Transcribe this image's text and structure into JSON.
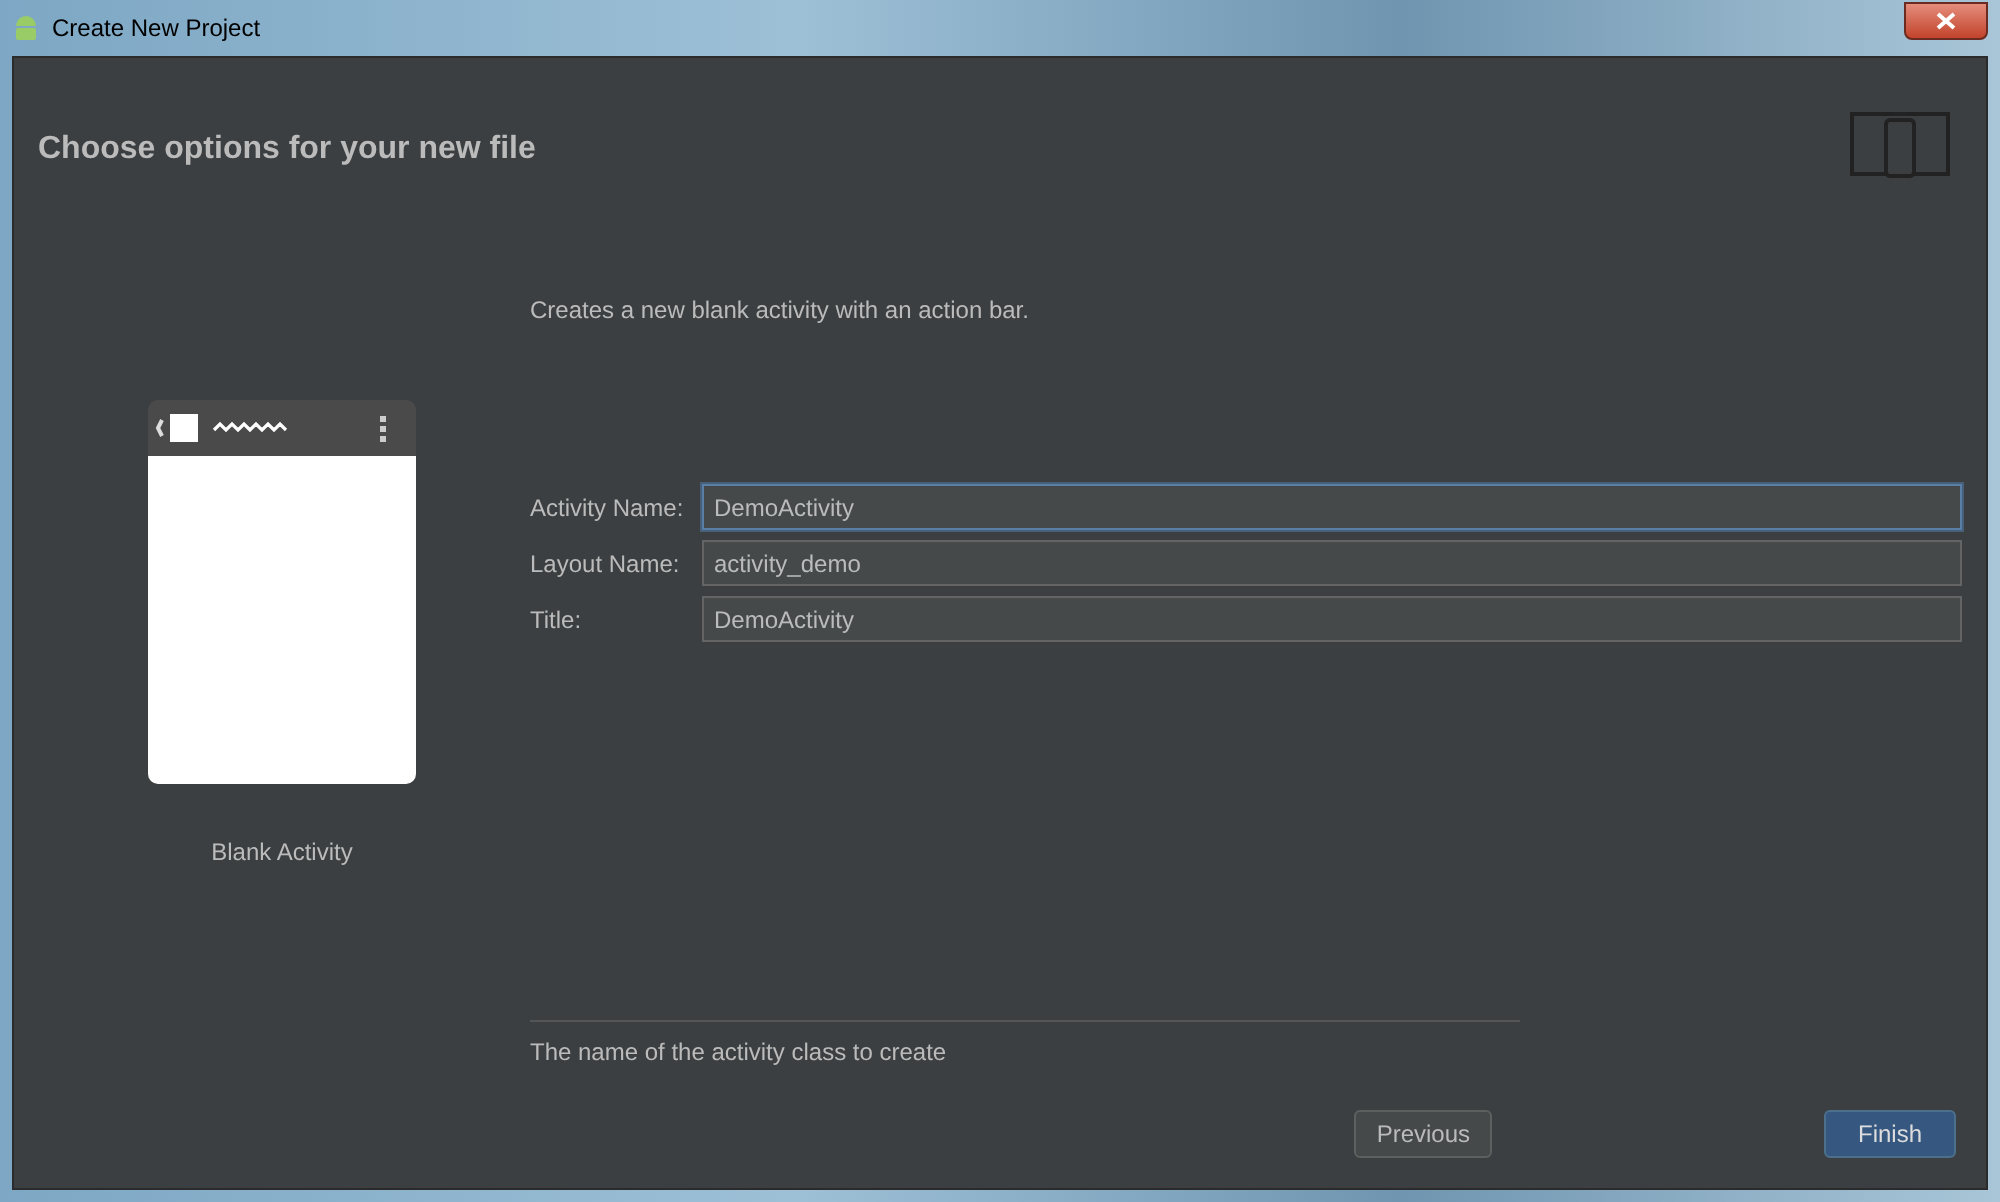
{
  "window": {
    "title": "Create New Project"
  },
  "header": {
    "title": "Choose options for your new file"
  },
  "template": {
    "name": "Blank Activity"
  },
  "description": "Creates a new blank activity with an action bar.",
  "fields": [
    {
      "label": "Activity Name:",
      "value": "DemoActivity",
      "focused": true
    },
    {
      "label": "Layout Name:",
      "value": "activity_demo",
      "focused": false
    },
    {
      "label": "Title:",
      "value": "DemoActivity",
      "focused": false
    }
  ],
  "help_text": "The name of the activity class to create",
  "buttons": [
    {
      "label": "Previous",
      "kind": "secondary"
    },
    {
      "label": "Finish",
      "kind": "primary"
    }
  ]
}
